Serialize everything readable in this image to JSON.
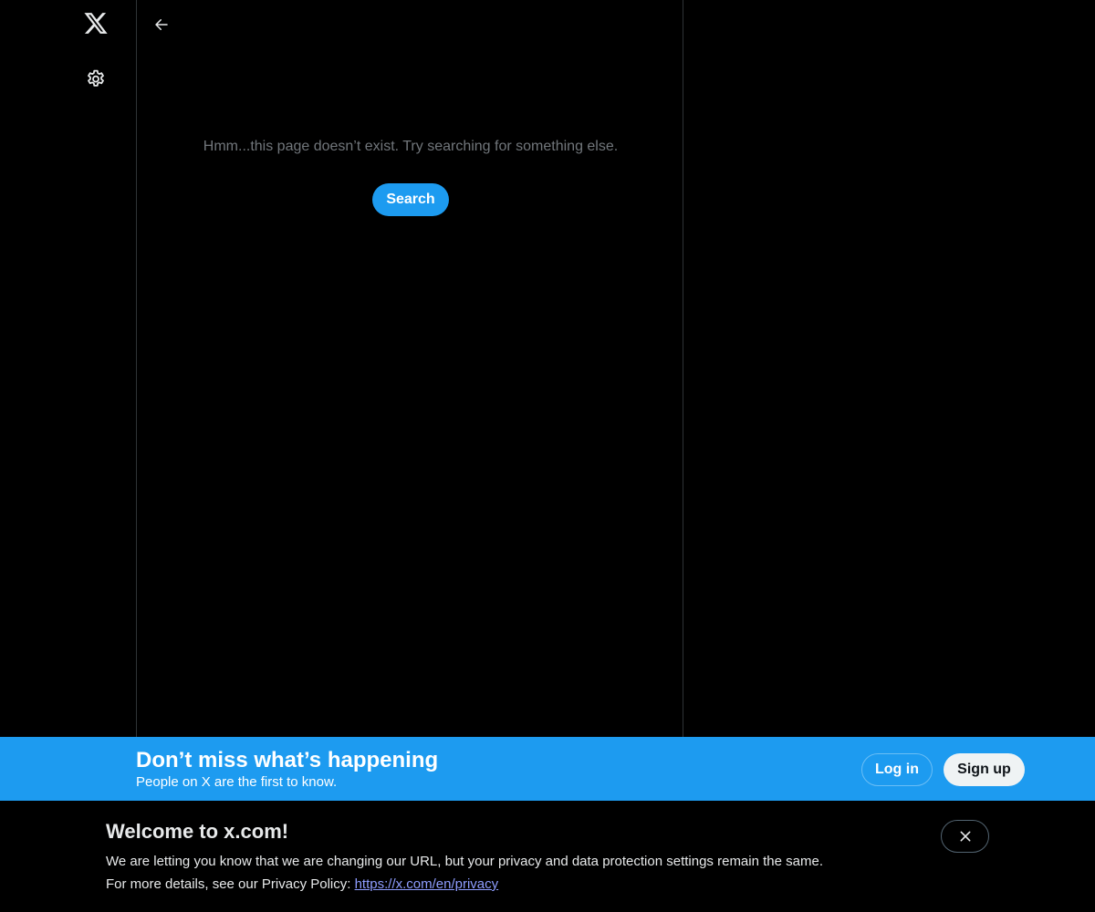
{
  "nav": {
    "logo_icon": "x-logo-icon",
    "settings_icon": "gear-icon"
  },
  "main": {
    "back_icon": "arrow-left-icon",
    "empty_message": "Hmm...this page doesn’t exist. Try searching for something else.",
    "search_label": "Search"
  },
  "bottom_bar": {
    "title": "Don’t miss what’s happening",
    "subtitle": "People on X are the first to know.",
    "login_label": "Log in",
    "signup_label": "Sign up",
    "background_color": "#1d9bf0"
  },
  "notice": {
    "title": "Welcome to x.com!",
    "line1": "We are letting you know that we are changing our URL, but your privacy and data protection settings remain the same.",
    "line2_prefix": "For more details, see our Privacy Policy: ",
    "privacy_link": "https://x.com/en/privacy",
    "close_icon": "close-icon"
  },
  "colors": {
    "background": "#000000",
    "accent": "#1d9bf0",
    "muted_text": "#71767b",
    "link": "#8e9dff"
  }
}
